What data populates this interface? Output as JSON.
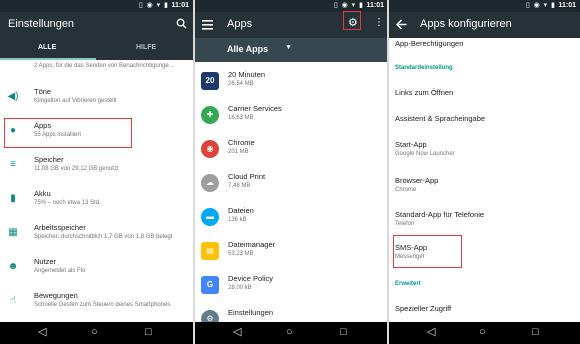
{
  "status_bar": {
    "time": "11:01",
    "icons": "▯ ◉ ▾ ▮"
  },
  "panel1": {
    "title": "Einstellungen",
    "tabs": [
      "ALLE",
      "HILFE"
    ],
    "items": [
      {
        "title": "",
        "subtitle": "2 Apps, für die das Senden von Benachrichtigunge...",
        "icon": "notifications-icon"
      },
      {
        "title": "Töne",
        "subtitle": "Klingelton auf Vibrieren gestellt",
        "icon": "volume-icon"
      },
      {
        "title": "Apps",
        "subtitle": "55 Apps installiert",
        "icon": "android-icon"
      },
      {
        "title": "Speicher",
        "subtitle": "11,08 GB von 29,12 GB genutzt",
        "icon": "storage-icon"
      },
      {
        "title": "Akku",
        "subtitle": "75% – noch etwa 13 Std.",
        "icon": "battery-icon"
      },
      {
        "title": "Arbeitsspeicher",
        "subtitle": "Speicher: durchschnittlich 1,7 GB von 1,8 GB belegt",
        "icon": "memory-icon"
      },
      {
        "title": "Nutzer",
        "subtitle": "Angemeldet als Flo",
        "icon": "person-icon"
      },
      {
        "title": "Bewegungen",
        "subtitle": "Schnelle Gesten zum Steuern deines Smartphones",
        "icon": "gesture-icon"
      }
    ]
  },
  "panel2": {
    "title": "Apps",
    "filter_label": "Alle Apps",
    "apps": [
      {
        "name": "20 Minuten",
        "size": "26,54 MB",
        "color": "#1a3a6b",
        "glyph": "20"
      },
      {
        "name": "Carrier Services",
        "size": "16,63 MB",
        "color": "#34a853",
        "glyph": "✚"
      },
      {
        "name": "Chrome",
        "size": "201 MB",
        "color": "#db4437",
        "glyph": "◉"
      },
      {
        "name": "Cloud Print",
        "size": "7,48 MB",
        "color": "#9e9e9e",
        "glyph": "☁"
      },
      {
        "name": "Dateien",
        "size": "136 kB",
        "color": "#03a9f4",
        "glyph": "▬"
      },
      {
        "name": "Dateimanager",
        "size": "53,23 MB",
        "color": "#ffc107",
        "glyph": "▤"
      },
      {
        "name": "Device Policy",
        "size": "28,00 kB",
        "color": "#4285f4",
        "glyph": "G"
      },
      {
        "name": "Einstellungen",
        "size": "",
        "color": "#607d8b",
        "glyph": "⚙"
      }
    ]
  },
  "panel3": {
    "title": "Apps konfigurieren",
    "top_item": "App-Berechtigungen",
    "section_default": "Standardeinstellung",
    "items": [
      {
        "title": "Links zum Öffnen",
        "subtitle": ""
      },
      {
        "title": "Assistent & Spracheingabe",
        "subtitle": ""
      },
      {
        "title": "Start-App",
        "subtitle": "Google Now Launcher"
      },
      {
        "title": "Browser-App",
        "subtitle": "Chrome"
      },
      {
        "title": "Standard-App für Telefonie",
        "subtitle": "Telefon"
      },
      {
        "title": "SMS-App",
        "subtitle": "Messenger"
      }
    ],
    "section_advanced": "Erweitert",
    "advanced_item": "Spezieller Zugriff"
  },
  "navbar": {
    "back": "◁",
    "home": "○",
    "recents": "□"
  }
}
